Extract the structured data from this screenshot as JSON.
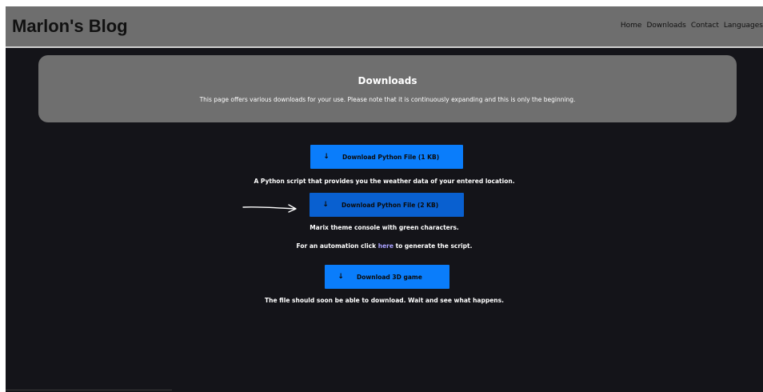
{
  "header": {
    "brand": "Marlon's Blog",
    "nav": [
      "Home",
      "Downloads",
      "Contact",
      "Languages"
    ]
  },
  "hero": {
    "title": "Downloads",
    "text": "This page offers various downloads for your use. Please note that it is continuously expanding and this is only the beginning."
  },
  "downloads": [
    {
      "arrow": "↓",
      "label": "Download Python File (1 KB)",
      "description": "A Python script that provides you the weather data of your entered location."
    },
    {
      "arrow": "↓",
      "label": "Download Python File (2 KB)",
      "description": "Marix theme console with green characters."
    },
    {
      "arrow": "↓",
      "label": "Download 3D game",
      "description": "The file should soon be able to download. Wait and see what happens."
    }
  ],
  "automation": {
    "prefix": "For an automation click ",
    "link": "here",
    "suffix": " to generate the script."
  },
  "colors": {
    "page_bg": "#141419",
    "header_bg": "#6e6e6e",
    "hero_bg": "#6f6f6f",
    "button": "#0a7dfb",
    "button_hover": "#0960d0",
    "link": "#a9a1ff"
  }
}
